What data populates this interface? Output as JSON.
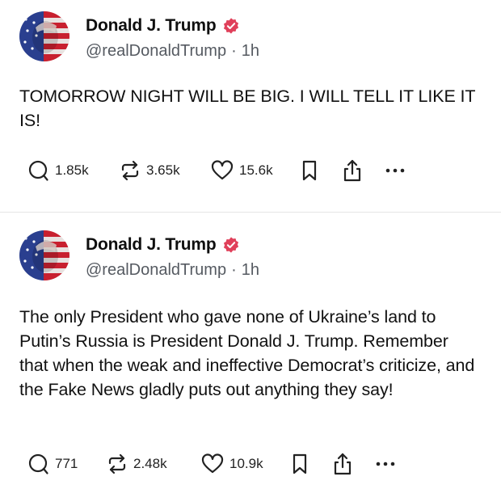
{
  "colors": {
    "verified": "#e0405a",
    "text": "#111111",
    "muted": "#555a61",
    "divider": "#e6e6e6"
  },
  "posts": [
    {
      "author": {
        "display_name": "Donald J. Trump",
        "handle": "@realDonaldTrump",
        "time": "1h",
        "avatar": "flag-face-avatar",
        "verified_icon": "verified-badge-icon"
      },
      "text": "TOMORROW NIGHT WILL BE BIG. I WILL TELL IT LIKE IT IS!",
      "actions": {
        "replies": "1.85k",
        "reposts": "3.65k",
        "likes": "15.6k"
      }
    },
    {
      "author": {
        "display_name": "Donald J. Trump",
        "handle": "@realDonaldTrump",
        "time": "1h",
        "avatar": "flag-face-avatar",
        "verified_icon": "verified-badge-icon"
      },
      "text": "The only President who gave none of Ukraine’s land to Putin’s Russia is President Donald J. Trump. Remember that when the weak and ineffective Democrat’s criticize, and the Fake News gladly puts out anything they say!",
      "actions": {
        "replies": "771",
        "reposts": "2.48k",
        "likes": "10.9k"
      }
    }
  ]
}
